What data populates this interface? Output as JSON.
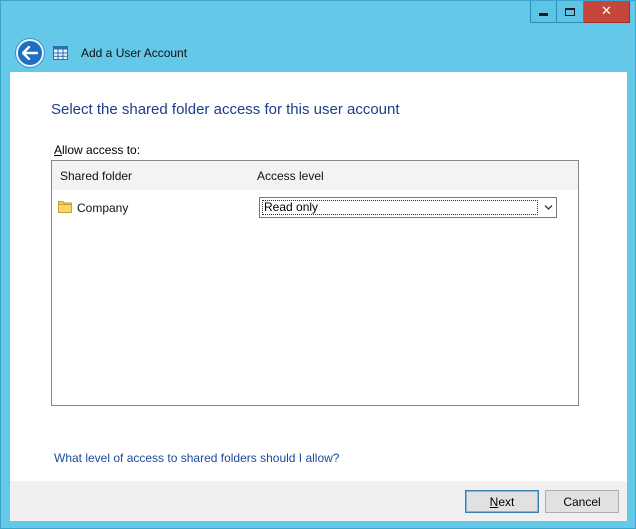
{
  "window": {
    "title": "Add a User Account",
    "controls": {
      "minimize": "minimize",
      "maximize": "maximize",
      "close": "✕"
    }
  },
  "icons": {
    "back": "back-arrow-icon",
    "app": "grid-app-icon",
    "folder": "folder-icon",
    "dropdown": "chevron-down-icon"
  },
  "colors": {
    "frame": "#64c8e8",
    "close": "#c7463b",
    "heading": "#1b3d8a",
    "link": "#1c4aa0",
    "back_button": "#1e6fc0"
  },
  "page": {
    "heading": "Select the shared folder access for this user account",
    "allow_label_mnemonic": "A",
    "allow_label_rest": "llow access to:",
    "table": {
      "columns": [
        "Shared folder",
        "Access level"
      ],
      "rows": [
        {
          "folder": "Company",
          "access_level": "Read only"
        }
      ]
    },
    "help_link": "What level of access to shared folders should I allow?"
  },
  "footer": {
    "next_mnemonic": "N",
    "next_rest": "ext",
    "cancel": "Cancel"
  }
}
